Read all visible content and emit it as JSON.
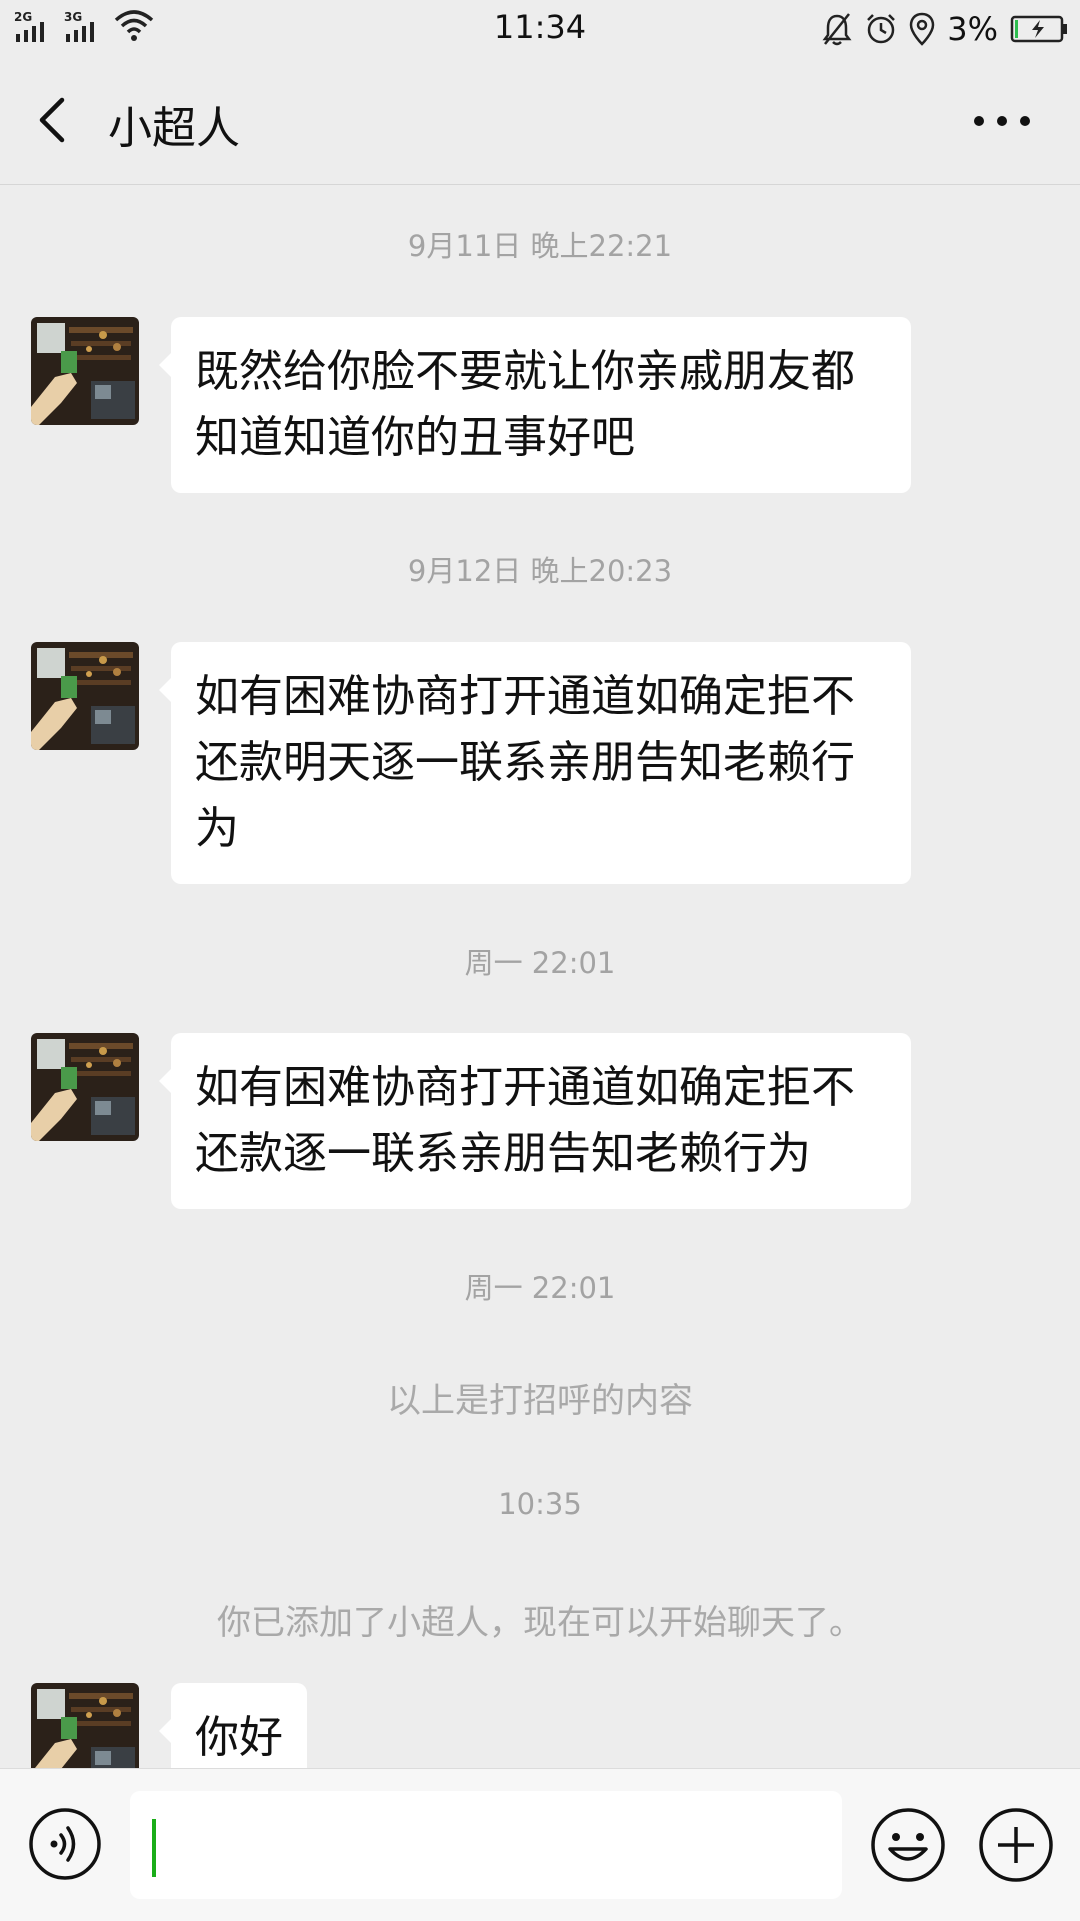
{
  "status_bar": {
    "net1": "2G",
    "net2": "3G",
    "time": "11:34",
    "battery_pct": "3%"
  },
  "nav": {
    "title": "小超人"
  },
  "messages": [
    {
      "type": "timestamp",
      "text": "9月11日 晚上22:21"
    },
    {
      "type": "incoming",
      "lines": [
        "既然给你脸不要就让你亲戚朋友都",
        "知道知道你的丑事好吧"
      ]
    },
    {
      "type": "timestamp",
      "text": "9月12日 晚上20:23"
    },
    {
      "type": "incoming",
      "lines": [
        "如有困难协商打开通道如确定拒不",
        "还款明天逐一联系亲朋告知老赖行",
        "为"
      ]
    },
    {
      "type": "timestamp",
      "text": "周一 22:01"
    },
    {
      "type": "incoming",
      "lines": [
        "如有困难协商打开通道如确定拒不",
        "还款逐一联系亲朋告知老赖行为"
      ]
    },
    {
      "type": "timestamp",
      "text": "周一 22:01"
    },
    {
      "type": "system",
      "text": "以上是打招呼的内容"
    },
    {
      "type": "timestamp",
      "text": "10:35"
    },
    {
      "type": "system",
      "text": "你已添加了小超人，现在可以开始聊天了。"
    },
    {
      "type": "incoming",
      "lines": [
        "你好"
      ]
    }
  ],
  "input": {
    "value": ""
  },
  "icons": {
    "back": "back-arrow-icon",
    "more": "more-dots-icon",
    "voice": "voice-icon",
    "emoji": "emoji-icon",
    "plus": "plus-icon"
  }
}
